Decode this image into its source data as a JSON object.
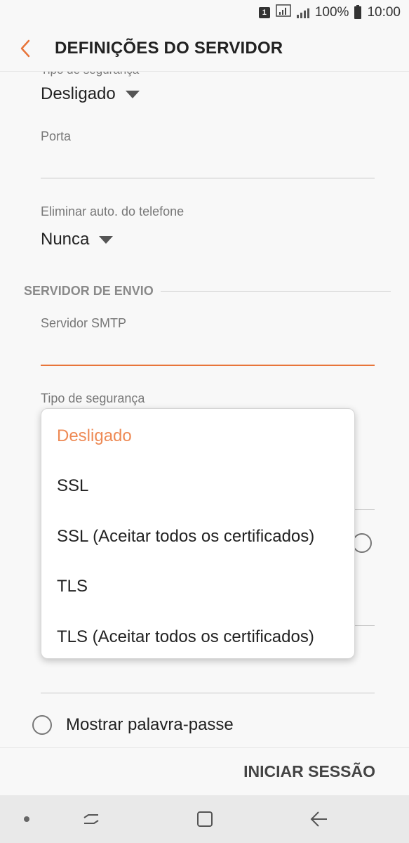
{
  "status_bar": {
    "notification_badge": "1",
    "battery_percent": "100%",
    "time": "10:00"
  },
  "header": {
    "title": "DEFINIÇÕES DO SERVIDOR",
    "back_icon": "chevron-left-icon",
    "accent_color": "#e8753a"
  },
  "incoming": {
    "security_label_cut": "Tipo de segurança",
    "security_value": "Desligado",
    "port_label": "Porta",
    "port_value": "",
    "auto_delete_label": "Eliminar auto. do telefone",
    "auto_delete_value": "Nunca"
  },
  "outgoing": {
    "section_title": "SERVIDOR DE ENVIO",
    "smtp_label": "Servidor SMTP",
    "smtp_value": "",
    "security_label": "Tipo de segurança"
  },
  "dropdown": {
    "options": [
      "Desligado",
      "SSL",
      "SSL (Aceitar todos os certificados)",
      "TLS",
      "TLS (Aceitar todos os certificados)"
    ],
    "selected_index": 0
  },
  "show_password": {
    "label": "Mostrar palavra-passe",
    "checked": false
  },
  "actions": {
    "sign_in": "INICIAR SESSÃO"
  },
  "nav_bar": {
    "icons": [
      "dot-icon",
      "recent-apps-icon",
      "home-icon",
      "back-icon"
    ]
  }
}
